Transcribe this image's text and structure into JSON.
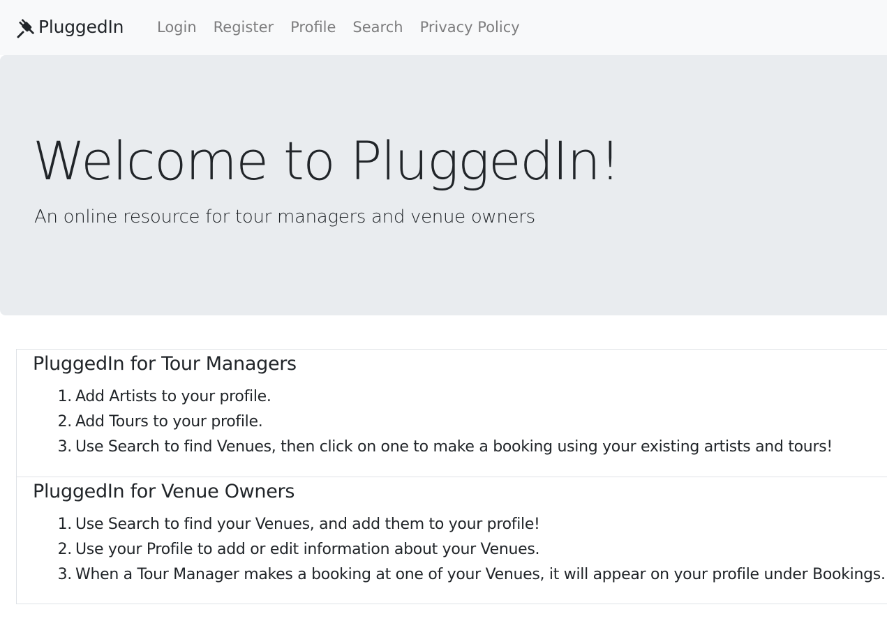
{
  "navbar": {
    "brand": "PluggedIn",
    "links": [
      "Login",
      "Register",
      "Profile",
      "Search",
      "Privacy Policy"
    ]
  },
  "hero": {
    "title": "Welcome to PluggedIn!",
    "subtitle": "An online resource for tour managers and venue owners"
  },
  "sections": [
    {
      "heading": "PluggedIn for Tour Managers",
      "items": [
        "Add Artists to your profile.",
        "Add Tours to your profile.",
        "Use Search to find Venues, then click on one to make a booking using your existing artists and tours!"
      ]
    },
    {
      "heading": "PluggedIn for Venue Owners",
      "items": [
        "Use Search to find your Venues, and add them to your profile!",
        "Use your Profile to add or edit information about your Venues.",
        "When a Tour Manager makes a booking at one of your Venues, it will appear on your profile under Bookings."
      ]
    }
  ],
  "icons": {
    "brand_icon": "plug-icon"
  },
  "colors": {
    "navbar_bg": "#f8f9fa",
    "hero_bg": "#e9ecef",
    "nav_link": "#7f8081",
    "text": "#212529"
  }
}
